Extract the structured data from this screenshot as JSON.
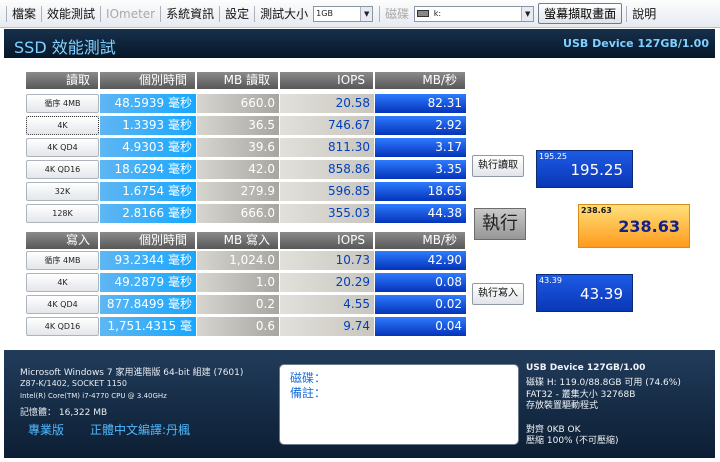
{
  "menu": {
    "file": "檔案",
    "benchmark": "效能測試",
    "iometer": "IOmeter",
    "sysinfo": "系統資訊",
    "settings": "設定",
    "test_size_label": "測試大小",
    "test_size_value": "1GB",
    "disk_label": "磁碟",
    "drive_value": "k:",
    "screenshot": "螢幕擷取畫面",
    "help": "說明"
  },
  "title": {
    "app": "SSD 效能測試",
    "device": "USB Device 127GB/1.00"
  },
  "read": {
    "headers": [
      "讀取",
      "個別時間",
      "MB 讀取",
      "IOPS",
      "MB/秒"
    ],
    "rows": [
      {
        "label": "循序 4MB",
        "time": "48.5939 毫秒",
        "mb": "660.0",
        "iops": "20.58",
        "mbs": "82.31"
      },
      {
        "label": "4K",
        "time": "1.3393 毫秒",
        "mb": "36.5",
        "iops": "746.67",
        "mbs": "2.92"
      },
      {
        "label": "4K QD4",
        "time": "4.9303 毫秒",
        "mb": "39.6",
        "iops": "811.30",
        "mbs": "3.17"
      },
      {
        "label": "4K QD16",
        "time": "18.6294 毫秒",
        "mb": "42.0",
        "iops": "858.86",
        "mbs": "3.35"
      },
      {
        "label": "32K",
        "time": "1.6754 毫秒",
        "mb": "279.9",
        "iops": "596.85",
        "mbs": "18.65"
      },
      {
        "label": "128K",
        "time": "2.8166 毫秒",
        "mb": "666.0",
        "iops": "355.03",
        "mbs": "44.38"
      }
    ]
  },
  "write": {
    "headers": [
      "寫入",
      "個別時間",
      "MB 寫入",
      "IOPS",
      "MB/秒"
    ],
    "rows": [
      {
        "label": "循序 4MB",
        "time": "93.2344 毫秒",
        "mb": "1,024.0",
        "iops": "10.73",
        "mbs": "42.90"
      },
      {
        "label": "4K",
        "time": "49.2879 毫秒",
        "mb": "1.0",
        "iops": "20.29",
        "mbs": "0.08"
      },
      {
        "label": "4K QD4",
        "time": "877.8499 毫秒",
        "mb": "0.2",
        "iops": "4.55",
        "mbs": "0.02"
      },
      {
        "label": "4K QD16",
        "time": "1,751.4315 毫",
        "mb": "0.6",
        "iops": "9.74",
        "mbs": "0.04"
      }
    ]
  },
  "actions": {
    "run_read": "執行讀取",
    "run": "執行",
    "run_write": "執行寫入"
  },
  "results": {
    "read_small": "195.25",
    "read_big": "195.25",
    "total_small": "238.63",
    "total_big": "238.63",
    "write_small": "43.39",
    "write_big": "43.39"
  },
  "sysinfo": {
    "os": "Microsoft Windows 7 家用進階版 64-bit 組建  (7601)",
    "board": "Z87-K/1402, SOCKET 1150",
    "cpu": "Intel(R) Core(TM) i7-4770 CPU @ 3.40GHz",
    "memory": "記憶體：  16,322 MB",
    "pro": "專業版",
    "translator": "正體中文編譯:丹楓"
  },
  "notes": {
    "disk": "磁碟：",
    "remark": "備註："
  },
  "device_info": {
    "name": "USB Device 127GB/1.00",
    "disk": "磁碟    H: 119.0/88.8GB 可用  (74.6%)",
    "fs": "FAT32 - 叢集大小          32768B",
    "driver": "存放裝置驅動程式",
    "align": "對齊       0KB OK",
    "compress": "壓縮       100% (不可壓縮)"
  }
}
